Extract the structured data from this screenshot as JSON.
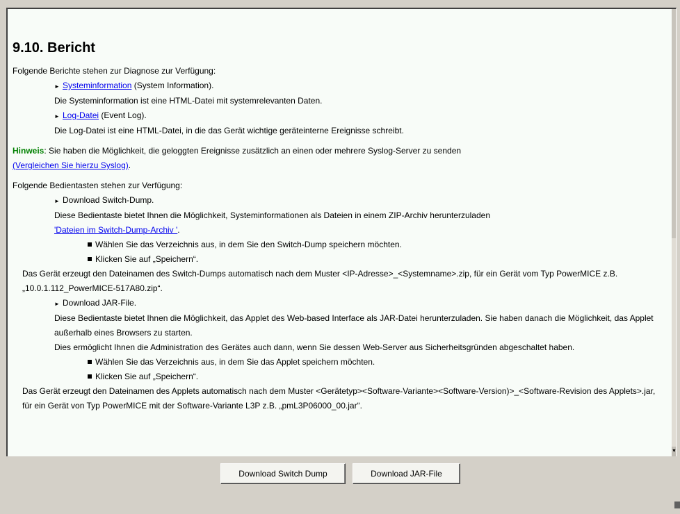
{
  "title": "9.10. Bericht",
  "intro": "Folgende Berichte stehen zur Diagnose zur Verfügung:",
  "reports": [
    {
      "link": "Systeminformation",
      "suffix": " (System Information).",
      "desc": "Die Systeminformation ist eine HTML-Datei mit systemrelevanten Daten."
    },
    {
      "link": "Log-Datei",
      "suffix": " (Event Log).",
      "desc": "Die Log-Datei ist eine HTML-Datei, in die das Gerät wichtige geräteinterne Ereignisse schreibt."
    }
  ],
  "note": {
    "label": "Hinweis",
    "text": ": Sie haben die Möglichkeit, die geloggten Ereignisse zusätzlich an einen oder mehrere Syslog-Server zu senden",
    "link": "(Vergleichen Sie hierzu Syslog)",
    "after": "."
  },
  "buttons_intro": "Folgende Bedientasten stehen zur Verfügung:",
  "switch_dump": {
    "heading": "Download Switch-Dump.",
    "desc": "Diese Bedientaste bietet Ihnen die Möglichkeit, Systeminformationen als Dateien in einem ZIP-Archiv herunterzuladen",
    "link": "'Dateien im Switch-Dump-Archiv '",
    "link_after": ".",
    "steps": [
      "Wählen Sie das Verzeichnis aus, in dem Sie den Switch-Dump speichern möchten.",
      "Klicken Sie auf „Speichern“."
    ],
    "filename_text": "Das Gerät erzeugt den Dateinamen des Switch-Dumps automatisch nach dem Muster <IP-Adresse>_<Systemname>.zip, für ein Gerät vom Typ PowerMICE z.B. „10.0.1.112_PowerMICE-517A80.zip“."
  },
  "jar_file": {
    "heading": "Download JAR-File.",
    "desc": "Diese Bedientaste bietet Ihnen die Möglichkeit, das Applet des Web-based Interface als JAR-Datei herunterzuladen. Sie haben danach die Möglichkeit, das Applet außerhalb eines Browsers zu starten.",
    "desc2": "Dies ermöglicht Ihnen die Administration des Gerätes auch dann, wenn Sie dessen Web-Server aus Sicherheitsgründen abgeschaltet haben.",
    "steps": [
      "Wählen Sie das Verzeichnis aus, in dem Sie das Applet speichern möchten.",
      "Klicken Sie auf „Speichern“."
    ],
    "filename_text": "Das Gerät erzeugt den Dateinamen des Applets automatisch nach dem Muster <Gerätetyp><Software-Variante><Software-Version)>_<Software-Revision des Applets>.jar, für ein Gerät von Typ PowerMICE mit der Software-Variante L3P z.B. „pmL3P06000_00.jar“."
  },
  "toolbar": {
    "download_switch_dump": "Download Switch Dump",
    "download_jar_file": "Download JAR-File"
  }
}
